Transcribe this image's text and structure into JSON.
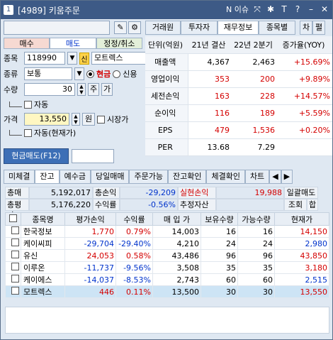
{
  "window": {
    "num": "1",
    "title": "[4989] 키움주문",
    "news": "N 이슈",
    "icons": [
      "pin-icon",
      "wrench-icon",
      "text-icon",
      "help-icon",
      "minimize-icon",
      "close-icon"
    ]
  },
  "left": {
    "top_btn_icons": [
      "edit-icon",
      "gear-icon"
    ],
    "tabs": [
      "매수",
      "매도",
      "정정/취소"
    ],
    "stock_label": "종목",
    "stock_code": "118990",
    "stock_sin": "신",
    "stock_name": "모트렉스",
    "type_label": "종류",
    "type_value": "보통",
    "cash": "현금",
    "credit": "신용",
    "qty_label": "수량",
    "qty_value": "30",
    "qty_btn1": "주",
    "qty_btn2": "가",
    "auto1": "자동",
    "price_label": "가격",
    "price_value": "13,550",
    "price_unit": "원",
    "market_price": "시장가",
    "auto2": "자동(현재가)",
    "submit": "현금매도(F12)"
  },
  "right": {
    "tabs": [
      "거래원",
      "투자자",
      "재무정보",
      "종목별",
      "차",
      "펼"
    ],
    "headers": [
      "단위(억원)",
      "21년 결산",
      "22년 2분기",
      "증가율(YOY)"
    ],
    "rows": [
      {
        "k": "매출액",
        "a": "4,367",
        "b": "2,463",
        "c": "+15.69%"
      },
      {
        "k": "영업이익",
        "a": "353",
        "b": "200",
        "c": "+9.89%"
      },
      {
        "k": "세전손익",
        "a": "163",
        "b": "228",
        "c": "+14.57%"
      },
      {
        "k": "순이익",
        "a": "116",
        "b": "189",
        "c": "+5.59%"
      },
      {
        "k": "EPS",
        "a": "479",
        "b": "1,536",
        "c": "+0.20%"
      },
      {
        "k": "PER",
        "a": "13.68",
        "b": "7.29",
        "c": ""
      }
    ]
  },
  "bottom": {
    "tabs": [
      "미체결",
      "잔고",
      "예수금",
      "당일매매",
      "주문가능",
      "잔고확인",
      "체결확인",
      "차트"
    ],
    "summary": {
      "l1": "총매입",
      "v1": "5,192,017",
      "l2": "총손익",
      "v2": "-29,209",
      "l3": "실현손익",
      "v3": "19,988",
      "l4": "일괄매도",
      "l5": "총평가",
      "v5": "5,176,220",
      "l6": "수익률",
      "v6": "-0.56%",
      "l7": "추정자산",
      "v7": "",
      "l8": "조회",
      "l9": "합"
    },
    "headers": [
      "종목명",
      "평가손익",
      "수익률",
      "매 입 가",
      "보유수량",
      "가능수량",
      "현재가"
    ],
    "rows": [
      [
        "한국정보",
        "1,770",
        "0.79%",
        "14,003",
        "16",
        "16",
        "14,150"
      ],
      [
        "케이씨피",
        "-29,704",
        "-29.40%",
        "4,210",
        "24",
        "24",
        "2,980"
      ],
      [
        "유신",
        "24,053",
        "0.58%",
        "43,486",
        "96",
        "96",
        "43,850"
      ],
      [
        "이루온",
        "-11,737",
        "-9.56%",
        "3,508",
        "35",
        "35",
        "3,180"
      ],
      [
        "케이에스",
        "-14,037",
        "-8.53%",
        "2,743",
        "60",
        "60",
        "2,515"
      ],
      [
        "모트렉스",
        "446",
        "0.11%",
        "13,500",
        "30",
        "30",
        "13,550"
      ]
    ]
  }
}
